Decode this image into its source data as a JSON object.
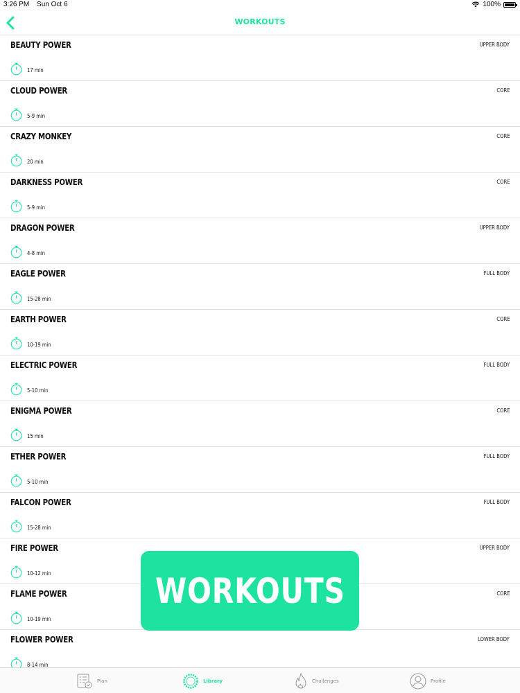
{
  "status_bar": {
    "time": "3:26 PM",
    "date": "Sun Oct 6",
    "battery": "100%"
  },
  "nav": {
    "title": "WORKOUTS",
    "back_icon": "chevron-left-icon"
  },
  "workouts": [
    {
      "name": "BEAUTY POWER",
      "category": "UPPER BODY",
      "duration": "17 min"
    },
    {
      "name": "CLOUD POWER",
      "category": "CORE",
      "duration": "5-9 min"
    },
    {
      "name": "CRAZY MONKEY",
      "category": "CORE",
      "duration": "20 min"
    },
    {
      "name": "DARKNESS POWER",
      "category": "CORE",
      "duration": "5-9 min"
    },
    {
      "name": "DRAGON POWER",
      "category": "UPPER BODY",
      "duration": "4-8 min"
    },
    {
      "name": "EAGLE POWER",
      "category": "FULL BODY",
      "duration": "15-28 min"
    },
    {
      "name": "EARTH POWER",
      "category": "CORE",
      "duration": "10-19 min"
    },
    {
      "name": "ELECTRIC POWER",
      "category": "FULL BODY",
      "duration": "5-10 min"
    },
    {
      "name": "ENIGMA POWER",
      "category": "CORE",
      "duration": "15 min"
    },
    {
      "name": "ETHER POWER",
      "category": "FULL BODY",
      "duration": "5-10 min"
    },
    {
      "name": "FALCON POWER",
      "category": "FULL BODY",
      "duration": "15-28 min"
    },
    {
      "name": "FIRE POWER",
      "category": "UPPER BODY",
      "duration": "10-12 min"
    },
    {
      "name": "FLAME POWER",
      "category": "CORE",
      "duration": "10-19 min"
    },
    {
      "name": "FLOWER POWER",
      "category": "LOWER BODY",
      "duration": "8-14 min"
    }
  ],
  "overlay": {
    "label": "WORKOUTS"
  },
  "tabs": [
    {
      "label": "Plan",
      "icon": "plan-checklist-icon",
      "active": false
    },
    {
      "label": "Library",
      "icon": "library-ring-icon",
      "active": true
    },
    {
      "label": "Challenges",
      "icon": "flame-icon",
      "active": false
    },
    {
      "label": "Profile",
      "icon": "profile-icon",
      "active": false
    }
  ],
  "colors": {
    "accent": "#1ee3a0",
    "text": "#111111",
    "divider": "#e3e3e3",
    "inactive": "#888888"
  }
}
